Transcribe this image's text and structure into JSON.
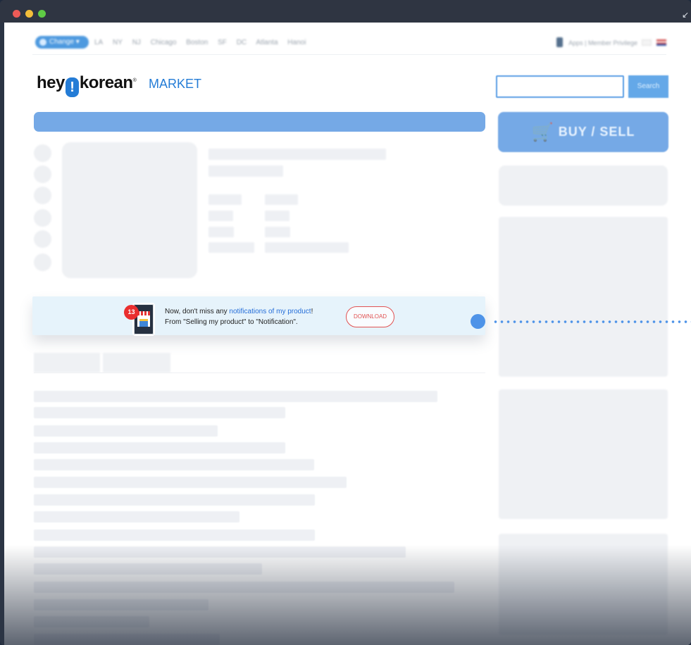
{
  "browser": {
    "traffic_lights": [
      "close",
      "minimize",
      "zoom"
    ],
    "resize_icon": "resize-icon"
  },
  "topbar": {
    "change_label": "Change",
    "cities": [
      "LA",
      "NY",
      "NJ",
      "Chicago",
      "Boston",
      "SF",
      "DC",
      "Atlanta",
      "Hanoi"
    ],
    "apps_label": "Apps",
    "member_label": "Member Privilege"
  },
  "header": {
    "logo_left": "hey",
    "logo_mark": "!",
    "logo_right": "korean",
    "logo_reg": "®",
    "market_label": "MARKET"
  },
  "search": {
    "placeholder": "",
    "button_label": "Search"
  },
  "buy_sell": {
    "label": "BUY / SELL"
  },
  "notification": {
    "badge": "13",
    "line1_prefix": "Now, don't miss any ",
    "line1_link": "notifications of my product",
    "line1_suffix": "!",
    "line2": "From \"Selling my product\" to \"Notification\".",
    "download_label": "DOWNLOAD"
  },
  "colors": {
    "accent": "#247cd6",
    "download_red": "#e15252",
    "notification_bg": "#e6f3fb"
  }
}
